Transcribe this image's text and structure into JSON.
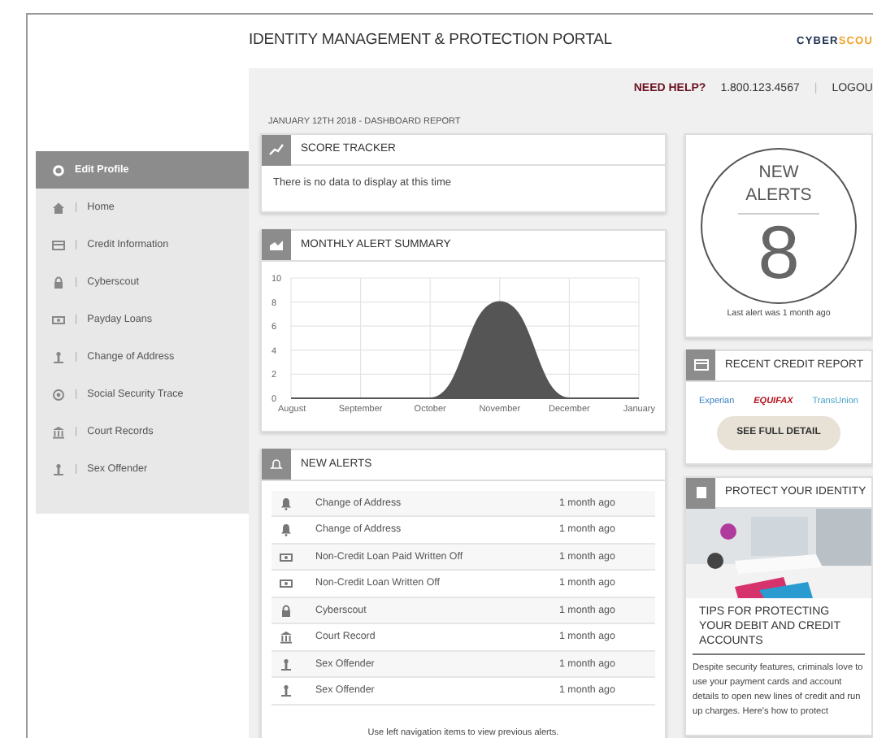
{
  "header": {
    "title": "IDENTITY MANAGEMENT & PROTECTION PORTAL",
    "logo": {
      "primary": "CYBER",
      "accent": "SCOU"
    }
  },
  "sidebar": {
    "items": [
      {
        "label": "Edit Profile",
        "kind": "gear",
        "selected": true
      },
      {
        "label": "Home",
        "kind": "home",
        "separator": "|",
        "selected": false
      },
      {
        "label": "Credit Information",
        "kind": "card",
        "separator": "|",
        "selected": false
      },
      {
        "label": "Cyberscout",
        "kind": "lock",
        "separator": "|",
        "selected": false
      },
      {
        "label": "Payday Loans",
        "kind": "money",
        "separator": "|",
        "selected": false
      },
      {
        "label": "Change of Address",
        "kind": "person",
        "separator": "|",
        "selected": false
      },
      {
        "label": "Social Security Trace",
        "kind": "circle",
        "separator": "|",
        "selected": false
      },
      {
        "label": "Court Records",
        "kind": "bank",
        "separator": "|",
        "selected": false
      },
      {
        "label": "Sex Offender",
        "kind": "person",
        "separator": "|",
        "selected": false
      }
    ]
  },
  "help_bar": {
    "help": "NEED HELP?",
    "phone": "1.800.123.4567",
    "separator": "|",
    "logout": "LOGOU"
  },
  "report_date": "JANUARY 12TH 2018 - DASHBOARD REPORT",
  "score_tracker": {
    "title": "SCORE TRACKER",
    "message": "There is no data to display at this time"
  },
  "monthly_summary": {
    "title": "MONTHLY ALERT SUMMARY",
    "chart_data": {
      "type": "area",
      "categories": [
        "August",
        "September",
        "October",
        "November",
        "December",
        "January"
      ],
      "values": [
        0,
        0,
        0,
        8,
        0,
        0
      ],
      "ylim": [
        0,
        10
      ],
      "yticks": [
        0,
        2,
        4,
        6,
        8,
        10
      ],
      "grid": true
    }
  },
  "new_alerts": {
    "title": "NEW ALERTS",
    "rows": [
      {
        "kind": "bell",
        "title": "Change of Address",
        "time": "1 month ago"
      },
      {
        "kind": "bell",
        "title": "Change of Address",
        "time": "1 month ago"
      },
      {
        "kind": "money",
        "title": "Non-Credit Loan Paid Written Off",
        "time": "1 month ago"
      },
      {
        "kind": "money",
        "title": "Non-Credit Loan Written Off",
        "time": "1 month ago"
      },
      {
        "kind": "lock",
        "title": "Cyberscout",
        "time": "1 month ago"
      },
      {
        "kind": "bank",
        "title": "Court Record",
        "time": "1 month ago"
      },
      {
        "kind": "person",
        "title": "Sex Offender",
        "time": "1 month ago"
      },
      {
        "kind": "person",
        "title": "Sex Offender",
        "time": "1 month ago"
      }
    ],
    "footer": "Use left navigation items to view previous alerts."
  },
  "alert_counter": {
    "label": "NEW ALERTS",
    "count": "8",
    "caption": "Last alert was 1 month ago"
  },
  "credit_report": {
    "title": "RECENT CREDIT REPORT",
    "bureaus": [
      "Experian",
      "EQUIFAX",
      "TransUnion"
    ],
    "button": "SEE FULL DETAIL"
  },
  "protect": {
    "title": "PROTECT YOUR IDENTITY",
    "headline": "TIPS FOR PROTECTING YOUR DEBIT AND CREDIT ACCOUNTS",
    "body": "Despite security features, criminals love to use your payment cards and account details to open new lines of credit and run up charges. Here's how to protect"
  }
}
